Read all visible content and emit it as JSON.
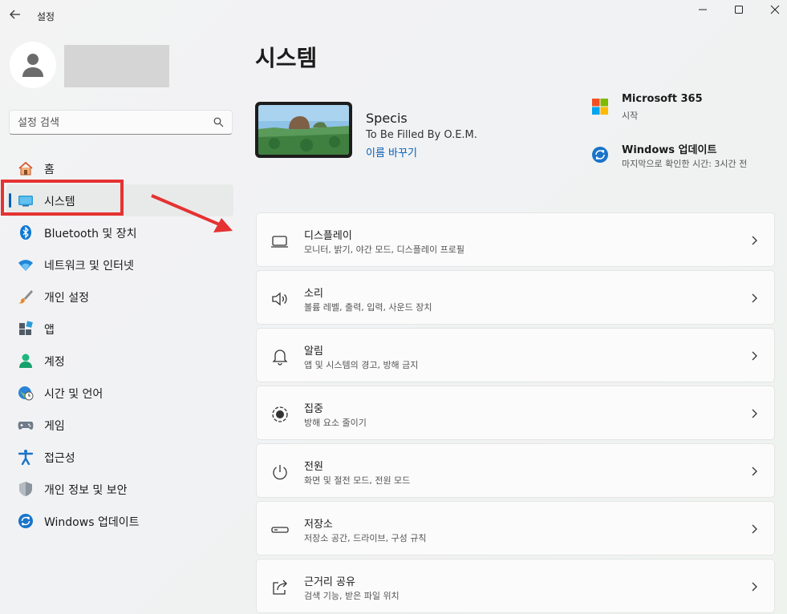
{
  "app": {
    "title": "설정"
  },
  "search": {
    "placeholder": "설정 검색"
  },
  "sidebar": {
    "items": [
      {
        "label": "홈",
        "icon": "home-icon"
      },
      {
        "label": "시스템",
        "icon": "system-icon",
        "selected": true
      },
      {
        "label": "Bluetooth 및 장치",
        "icon": "bluetooth-icon"
      },
      {
        "label": "네트워크 및 인터넷",
        "icon": "wifi-icon"
      },
      {
        "label": "개인 설정",
        "icon": "brush-icon"
      },
      {
        "label": "앱",
        "icon": "apps-icon"
      },
      {
        "label": "계정",
        "icon": "account-icon"
      },
      {
        "label": "시간 및 언어",
        "icon": "globe-clock-icon"
      },
      {
        "label": "게임",
        "icon": "gamepad-icon"
      },
      {
        "label": "접근성",
        "icon": "accessibility-icon"
      },
      {
        "label": "개인 정보 및 보안",
        "icon": "shield-icon"
      },
      {
        "label": "Windows 업데이트",
        "icon": "update-icon"
      }
    ]
  },
  "main": {
    "title": "시스템",
    "device": {
      "name": "Specis",
      "model": "To Be Filled By O.E.M.",
      "rename": "이름 바꾸기"
    },
    "ms365": {
      "title": "Microsoft 365",
      "subtitle": "시작"
    },
    "update": {
      "title": "Windows 업데이트",
      "subtitle": "마지막으로 확인한 시간: 3시간 전"
    },
    "cards": [
      {
        "title": "디스플레이",
        "subtitle": "모니터, 밝기, 야간 모드, 디스플레이 프로필",
        "icon": "display-icon"
      },
      {
        "title": "소리",
        "subtitle": "볼륨 레벨, 출력, 입력, 사운드 장치",
        "icon": "speaker-icon"
      },
      {
        "title": "알림",
        "subtitle": "앱 및 시스템의 경고, 방해 금지",
        "icon": "bell-icon"
      },
      {
        "title": "집중",
        "subtitle": "방해 요소 줄이기",
        "icon": "focus-icon"
      },
      {
        "title": "전원",
        "subtitle": "화면 및 절전 모드, 전원 모드",
        "icon": "power-icon"
      },
      {
        "title": "저장소",
        "subtitle": "저장소 공간, 드라이브, 구성 규칙",
        "icon": "storage-icon"
      },
      {
        "title": "근거리 공유",
        "subtitle": "검색 기능, 받은 파일 위치",
        "icon": "share-icon"
      }
    ]
  },
  "colors": {
    "accent": "#005fb8",
    "highlight": "#e53232"
  }
}
